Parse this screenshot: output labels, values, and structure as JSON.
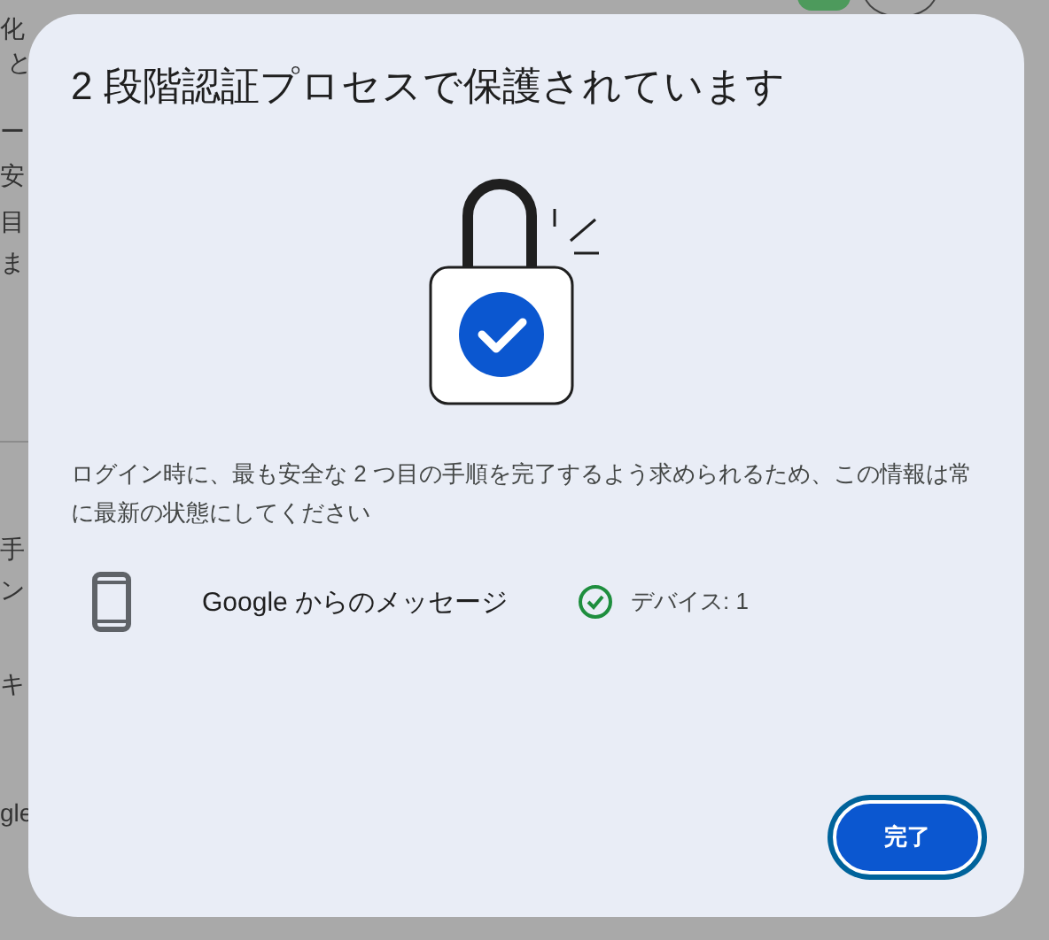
{
  "background_page": {
    "text_fragments": [
      "化",
      "と",
      "ー",
      "安",
      "目",
      "ま",
      "手",
      "ン",
      "キ",
      "gle"
    ]
  },
  "dialog": {
    "title": "2 段階認証プロセスで保護されています",
    "description": "ログイン時に、最も安全な 2 つ目の手順を完了するよう求められるため、この情報は常に最新の状態にしてください",
    "methods": [
      {
        "name": "Google からのメッセージ",
        "verified": true,
        "status": "デバイス: 1"
      }
    ],
    "buttons": [
      {
        "label": "完了",
        "focused": true
      }
    ]
  }
}
